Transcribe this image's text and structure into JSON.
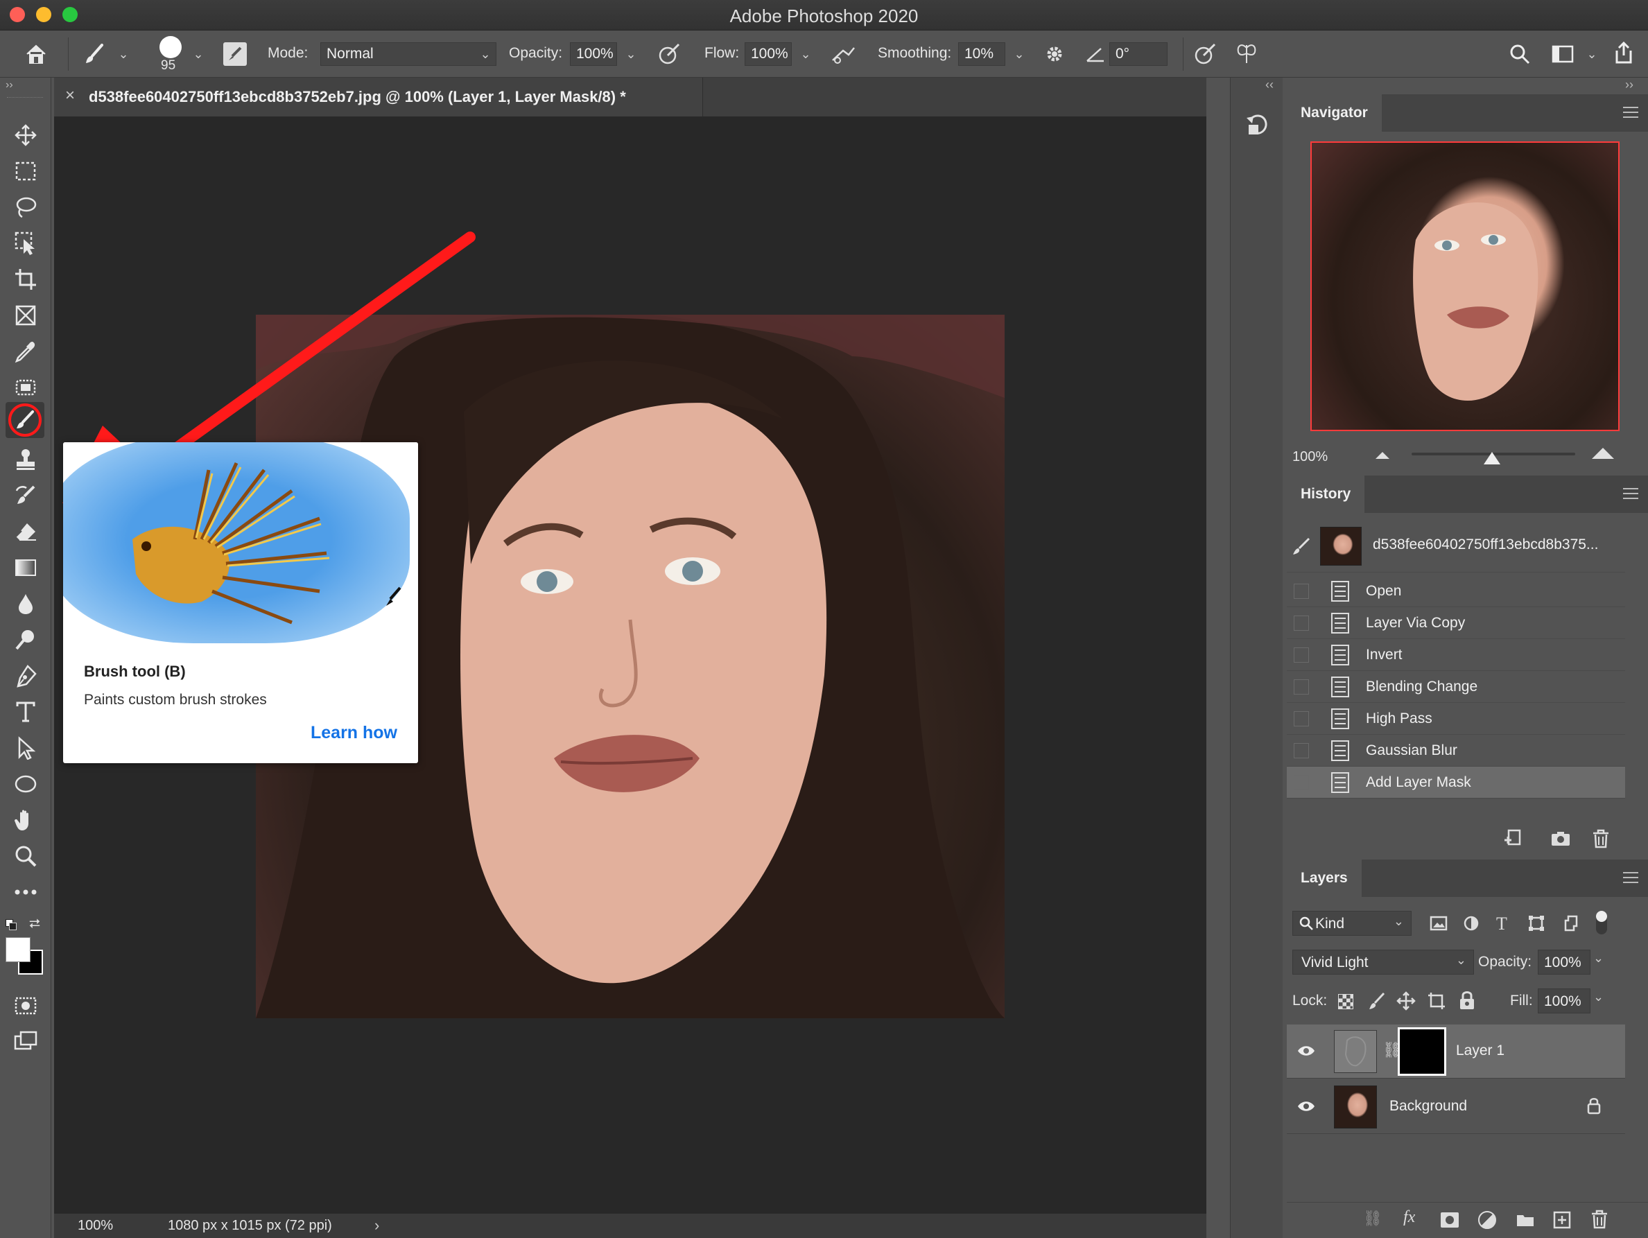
{
  "window": {
    "title": "Adobe Photoshop 2020",
    "traffic_lights": [
      "#fe5f57",
      "#febc2e",
      "#28c840"
    ]
  },
  "options_bar": {
    "brush_size": "95",
    "mode_label": "Mode:",
    "mode_value": "Normal",
    "opacity_label": "Opacity:",
    "opacity_value": "100%",
    "flow_label": "Flow:",
    "flow_value": "100%",
    "smoothing_label": "Smoothing:",
    "smoothing_value": "10%",
    "angle_value": "0°"
  },
  "document": {
    "tab_title": "d538fee60402750ff13ebcd8b3752eb7.jpg @ 100% (Layer 1, Layer Mask/8) *",
    "zoom": "100%",
    "dimensions": "1080 px x 1015 px (72 ppi)"
  },
  "tooltip": {
    "title": "Brush tool (B)",
    "description": "Paints custom brush strokes",
    "link": "Learn how"
  },
  "navigator": {
    "tab": "Navigator",
    "zoom": "100%"
  },
  "history": {
    "tab": "History",
    "snapshot_name": "d538fee60402750ff13ebcd8b375...",
    "items": [
      {
        "label": "Open"
      },
      {
        "label": "Layer Via Copy"
      },
      {
        "label": "Invert"
      },
      {
        "label": "Blending Change"
      },
      {
        "label": "High Pass"
      },
      {
        "label": "Gaussian Blur"
      },
      {
        "label": "Add Layer Mask"
      }
    ]
  },
  "layers": {
    "tab": "Layers",
    "filter_kind": "Kind",
    "blend_mode": "Vivid Light",
    "opacity_label": "Opacity:",
    "opacity_value": "100%",
    "lock_label": "Lock:",
    "fill_label": "Fill:",
    "fill_value": "100%",
    "items": [
      {
        "name": "Layer 1"
      },
      {
        "name": "Background"
      }
    ]
  },
  "colors": {
    "annotation_arrow": "#ff1a1a",
    "selected_history": "#6b6b6b",
    "link_blue": "#1473e6"
  },
  "icons": [
    "home-icon",
    "brush-icon",
    "move-icon",
    "marquee-icon",
    "lasso-icon",
    "object-select-icon",
    "crop-icon",
    "frame-icon",
    "eyedropper-icon",
    "spot-heal-icon",
    "stamp-icon",
    "history-brush-icon",
    "eraser-icon",
    "gradient-icon",
    "blur-icon",
    "dodge-icon",
    "pen-icon",
    "type-icon",
    "path-select-icon",
    "ellipse-icon",
    "hand-icon",
    "zoom-icon",
    "more-icon",
    "gear-icon",
    "search-icon",
    "share-icon",
    "eye-icon",
    "lock-icon",
    "trash-icon",
    "camera-icon"
  ]
}
